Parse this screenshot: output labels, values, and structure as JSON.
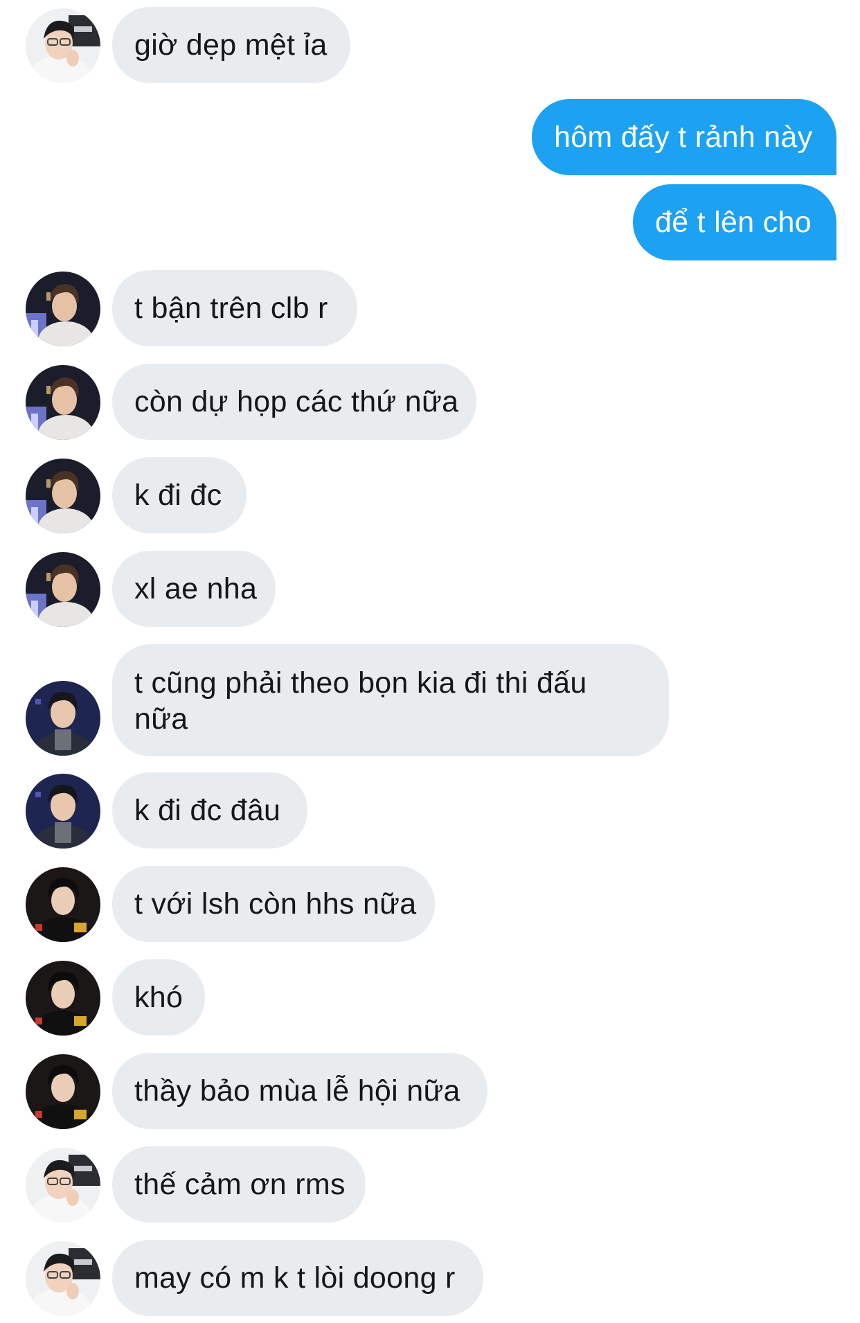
{
  "colors": {
    "incoming_bubble": "#e9ecef",
    "outgoing_bubble": "#1da1f2",
    "incoming_text": "#14171a",
    "outgoing_text": "#ffffff"
  },
  "messages": [
    {
      "direction": "in",
      "avatar": "user-glasses",
      "text": "giờ dẹp mệt ỉa"
    },
    {
      "direction": "out",
      "text": "hôm đấy t rảnh này"
    },
    {
      "direction": "out",
      "text": "để t lên cho"
    },
    {
      "direction": "in",
      "avatar": "user-stage",
      "text": "t bận trên clb r"
    },
    {
      "direction": "in",
      "avatar": "user-stage",
      "text": "còn dự họp các thứ nữa"
    },
    {
      "direction": "in",
      "avatar": "user-stage",
      "text": "k đi đc"
    },
    {
      "direction": "in",
      "avatar": "user-stage",
      "text": "xl ae nha"
    },
    {
      "direction": "in",
      "avatar": "user-navy",
      "text": "t cũng phải theo bọn kia đi thi đấu nữa"
    },
    {
      "direction": "in",
      "avatar": "user-navy",
      "text": "k đi đc đâu"
    },
    {
      "direction": "in",
      "avatar": "user-dark",
      "text": "t với lsh còn hhs nữa"
    },
    {
      "direction": "in",
      "avatar": "user-dark",
      "text": "khó"
    },
    {
      "direction": "in",
      "avatar": "user-dark",
      "text": "thầy bảo mùa lễ hội nữa"
    },
    {
      "direction": "in",
      "avatar": "user-glasses",
      "text": "thế cảm ơn rms"
    },
    {
      "direction": "in",
      "avatar": "user-glasses",
      "text": "may có m k t lòi doong r"
    }
  ]
}
